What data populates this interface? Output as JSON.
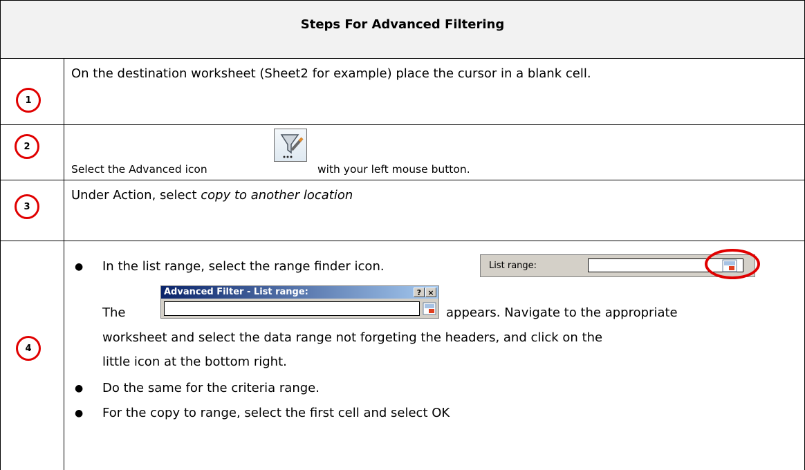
{
  "title": "Steps For Advanced Filtering",
  "steps": [
    {
      "number": "1",
      "text": "On the destination worksheet (Sheet2 for example) place the cursor in a blank cell."
    },
    {
      "number": "2",
      "text_before": "Select the Advanced icon",
      "text_after": "with your left mouse button."
    },
    {
      "number": "3",
      "text": "Under Action, select ",
      "text_italic": "copy to another location"
    },
    {
      "number": "4",
      "bullet1": "In the list range, select the range finder icon.",
      "line_the": "The",
      "line_appears": "appears. Navigate to the appropriate",
      "line_worksheet": "worksheet and select the data range not forgeting the headers, and click on the",
      "line_little": "little icon at the bottom right.",
      "bullet2": "Do the same for the criteria range.",
      "bullet3": "For the copy to range, select the first cell and select OK"
    }
  ],
  "list_range_widget": {
    "label": "List range:"
  },
  "advanced_filter_dialog": {
    "title": "Advanced Filter - List range:",
    "help": "?",
    "close": "×"
  },
  "icons": [
    "advanced-filter-icon",
    "range-finder-icon"
  ],
  "colors": {
    "circle": "#e00000",
    "header_bg": "#f2f2f2",
    "dialog_title": "#0a246a"
  }
}
